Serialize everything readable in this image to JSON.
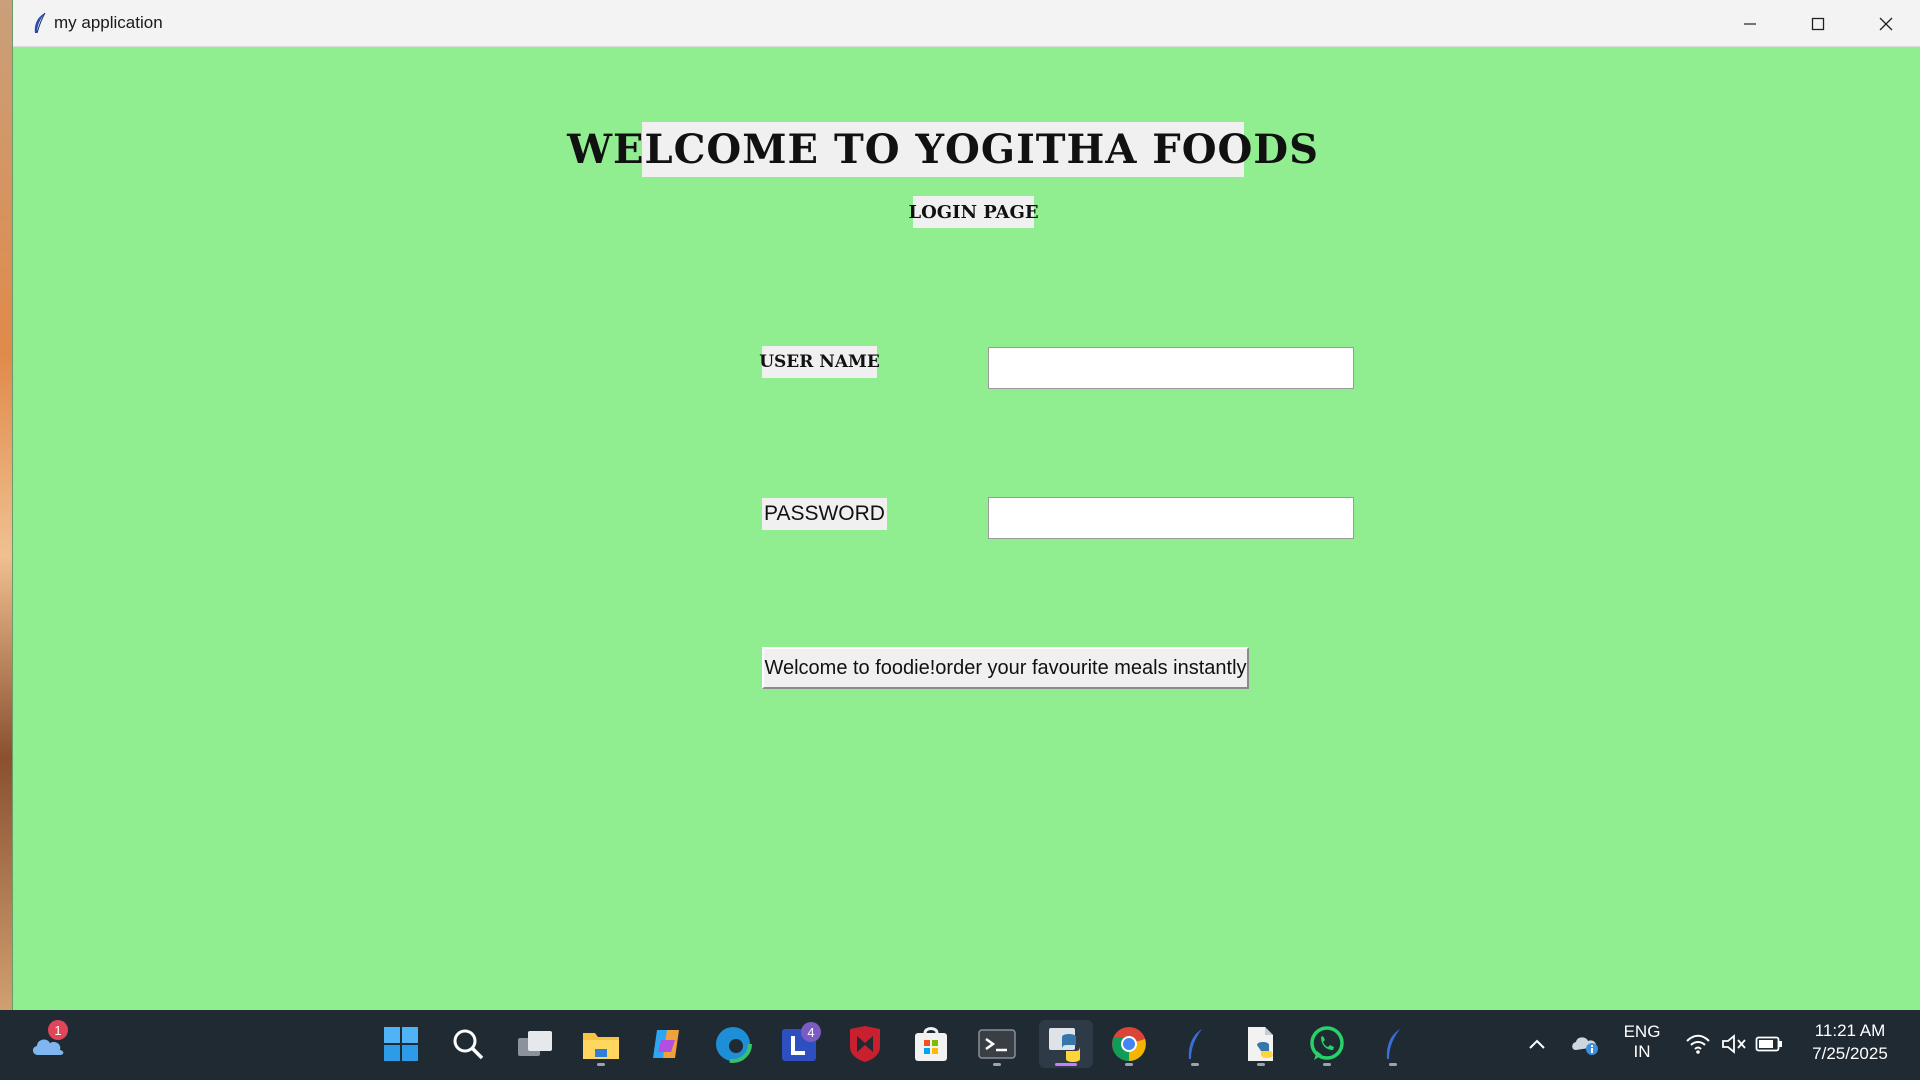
{
  "window": {
    "title": "my application"
  },
  "app": {
    "heading": "WELCOME TO YOGITHA FOODS",
    "subheading": "LOGIN PAGE",
    "username_label": "USER NAME",
    "password_label": "PASSWORD",
    "username_value": "",
    "password_value": "",
    "action_button": "Welcome to foodie!order your favourite meals instantly",
    "background_color": "#90ee90"
  },
  "taskbar": {
    "weather_badge": "1",
    "apps": [
      {
        "name": "start",
        "icon": "windows-logo-icon"
      },
      {
        "name": "search",
        "icon": "search-icon"
      },
      {
        "name": "task-view",
        "icon": "task-view-icon"
      },
      {
        "name": "file-explorer",
        "icon": "folder-icon"
      },
      {
        "name": "copilot",
        "icon": "copilot-icon"
      },
      {
        "name": "edge",
        "icon": "edge-icon"
      },
      {
        "name": "teams",
        "icon": "teams-icon",
        "badge": "4"
      },
      {
        "name": "mcafee",
        "icon": "mcafee-icon"
      },
      {
        "name": "store",
        "icon": "store-icon"
      },
      {
        "name": "terminal",
        "icon": "terminal-icon"
      },
      {
        "name": "python",
        "icon": "python-icon"
      },
      {
        "name": "chrome",
        "icon": "chrome-icon"
      },
      {
        "name": "tk-app-1",
        "icon": "feather-icon"
      },
      {
        "name": "python-file",
        "icon": "python-file-icon"
      },
      {
        "name": "whatsapp",
        "icon": "whatsapp-icon"
      },
      {
        "name": "tk-app-2",
        "icon": "feather-icon"
      }
    ],
    "language_top": "ENG",
    "language_bottom": "IN",
    "time": "11:21 AM",
    "date": "7/25/2025"
  }
}
